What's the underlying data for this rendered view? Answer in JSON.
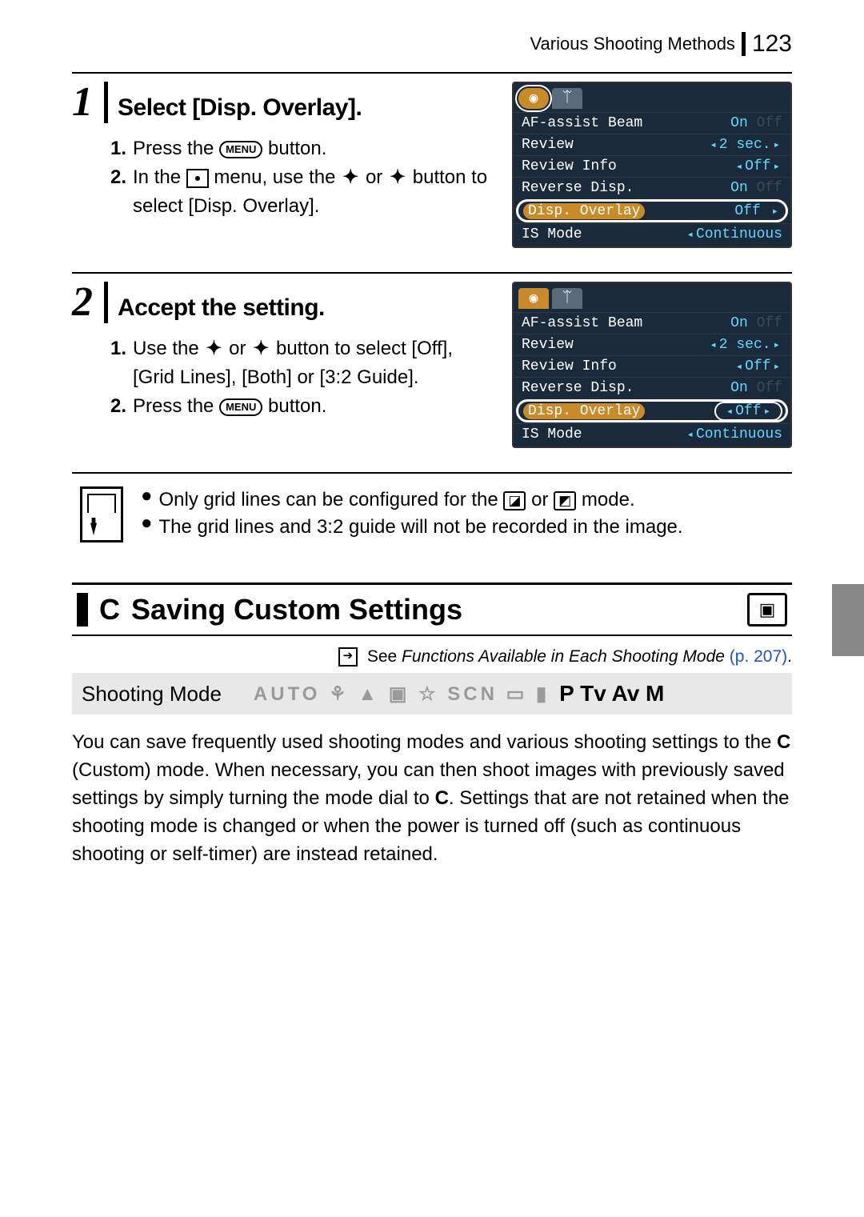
{
  "header": {
    "section_label": "Various Shooting Methods",
    "page_number": "123"
  },
  "steps": [
    {
      "num": "1",
      "title": "Select [Disp. Overlay].",
      "substeps": [
        {
          "n": "1.",
          "pre": "Press the ",
          "btn": "MENU",
          "post": " button."
        },
        {
          "n": "2.",
          "text": "In the  ▯  menu, use the  ✦ or ✦ button to select [Disp. Overlay]."
        }
      ],
      "lcd": {
        "tabs_active_first": true,
        "highlight_value_box": false,
        "rows": [
          {
            "label": "AF-assist Beam",
            "val": "On",
            "dim": "Off"
          },
          {
            "label": "Review",
            "val": "2 sec.",
            "carets": true
          },
          {
            "label": "Review Info",
            "val": "Off",
            "carets": true
          },
          {
            "label": "Reverse Disp.",
            "val": "On",
            "dim": "Off"
          },
          {
            "label": "Disp. Overlay",
            "val": "Off",
            "hilite": true,
            "carets_right": true
          },
          {
            "label": "IS Mode",
            "val": "Continuous",
            "carets": true
          }
        ]
      }
    },
    {
      "num": "2",
      "title": "Accept the setting.",
      "substeps": [
        {
          "n": "1.",
          "text": "Use the  ✦ or ✦  button to select [Off], [Grid Lines], [Both] or [3:2 Guide]."
        },
        {
          "n": "2.",
          "pre": "Press the ",
          "btn": "MENU",
          "post": " button."
        }
      ],
      "lcd": {
        "tabs_active_first": true,
        "highlight_value_box": true,
        "rows": [
          {
            "label": "AF-assist Beam",
            "val": "On",
            "dim": "Off"
          },
          {
            "label": "Review",
            "val": "2 sec.",
            "carets": true
          },
          {
            "label": "Review Info",
            "val": "Off",
            "carets": true
          },
          {
            "label": "Reverse Disp.",
            "val": "On",
            "dim": "Off"
          },
          {
            "label": "Disp. Overlay",
            "val": "Off",
            "hilite": true,
            "carets_both": true
          },
          {
            "label": "IS Mode",
            "val": "Continuous",
            "carets": true
          }
        ]
      }
    }
  ],
  "notes": [
    "Only grid lines can be configured for the  ▯  or  ▯  mode.",
    "The grid lines and 3:2 guide will not be recorded in the image."
  ],
  "section": {
    "icon_letter": "C",
    "title": "Saving Custom Settings",
    "see_prefix": "See ",
    "see_italic": "Functions Available in Each Shooting Mode",
    "see_page": "(p. 207)",
    "see_dot": "."
  },
  "mode_strip": {
    "label": "Shooting Mode",
    "gray": "AUTO  ⚘  ▲  ▣  ☆  SCN  ▭  ▮",
    "bold": "P Tv Av M"
  },
  "body": {
    "p1a": "You can save frequently used shooting modes and various shooting settings to the ",
    "c1": "C",
    "p1b": " (Custom) mode. When necessary, you can then shoot images with previously saved settings by simply turning the mode dial to ",
    "c2": "C",
    "p1c": ". Settings that are not retained when the shooting mode is changed or when the power is turned off (such as continuous shooting or self-timer) are instead retained."
  }
}
